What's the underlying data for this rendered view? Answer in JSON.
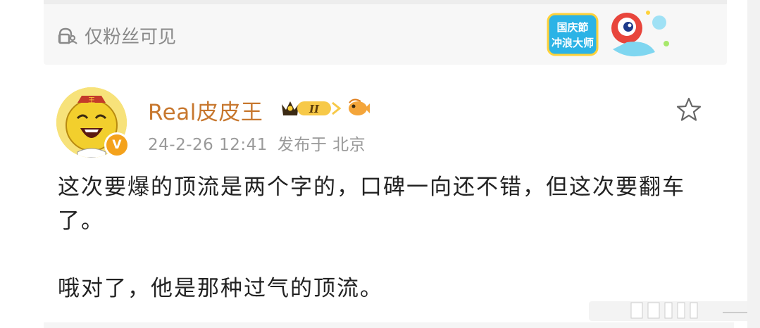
{
  "post": {
    "visibility_label": "仅粉丝可见",
    "author": {
      "name": "Real皮皮王",
      "vip_level": "II",
      "verified_mark": "V"
    },
    "meta": {
      "time": "24-2-26 12:41",
      "location": "发布于 北京"
    },
    "sticker_text": [
      "国庆節",
      "冲浪大师"
    ],
    "content": {
      "paragraph1": "这次要爆的顶流是两个字的，口碑一向还不错，但这次要翻车了。",
      "paragraph2": "哦对了，他是那种过气的顶流。"
    }
  },
  "icons": {
    "visibility": "lock-people-icon",
    "favorite": "star-icon",
    "vip": "crown-badge-icon",
    "fan": "fish-icon"
  },
  "colors": {
    "username": "#c7772e",
    "meta": "#9a9a9a",
    "content": "#222222",
    "visibility": "#8a8a8a",
    "verified": "#f4a21c"
  }
}
